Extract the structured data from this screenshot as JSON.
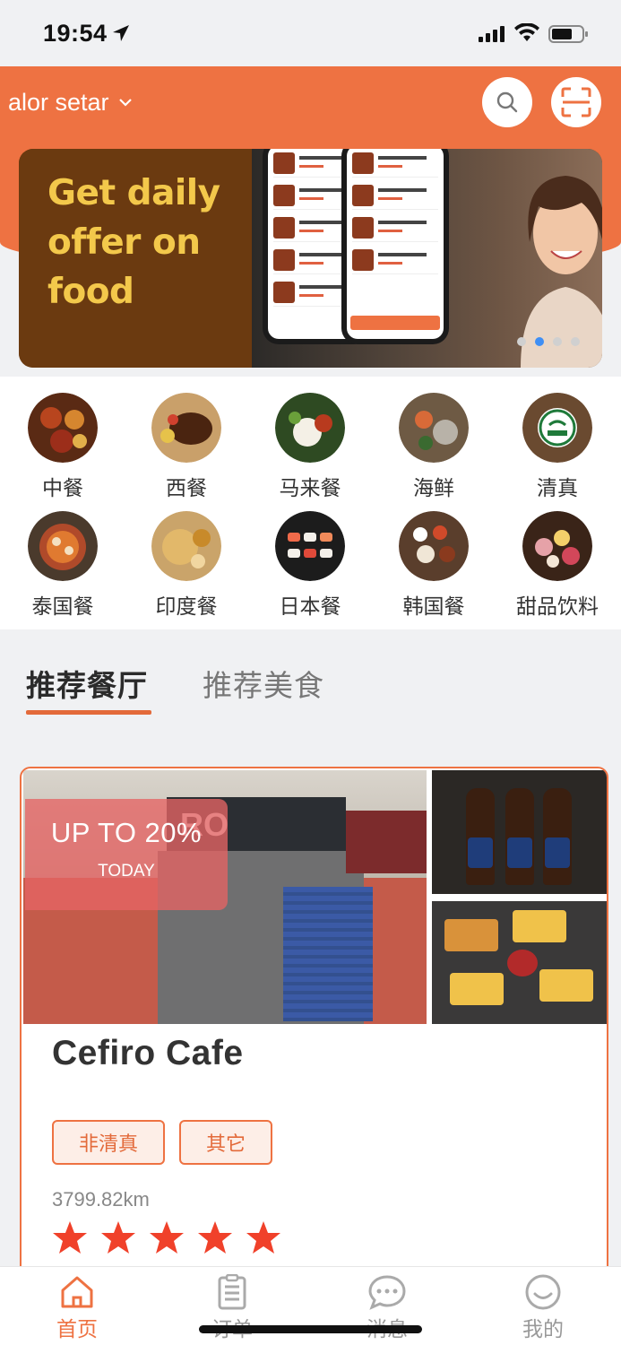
{
  "status_bar": {
    "time": "19:54"
  },
  "header": {
    "location": "alor setar"
  },
  "banner": {
    "lines": [
      "Get daily",
      "offer on",
      "food"
    ],
    "dots_total": 4,
    "active_dot": 2
  },
  "categories": [
    {
      "label": "中餐"
    },
    {
      "label": "西餐"
    },
    {
      "label": "马来餐"
    },
    {
      "label": "海鲜"
    },
    {
      "label": "清真"
    },
    {
      "label": "泰国餐"
    },
    {
      "label": "印度餐"
    },
    {
      "label": "日本餐"
    },
    {
      "label": "韩国餐"
    },
    {
      "label": "甜品饮料"
    }
  ],
  "tabs": {
    "active": "推荐餐厅",
    "inactive": "推荐美食"
  },
  "restaurant": {
    "name": "Cefiro Cafe",
    "promo": "UP TO 20%",
    "promo_sub": "TODAY",
    "sign_text": "RO",
    "tags": [
      "非清真",
      "其它"
    ],
    "distance": "3799.82km",
    "rating": 5
  },
  "nav": [
    {
      "label": "首页",
      "icon": "home-icon"
    },
    {
      "label": "订单",
      "icon": "orders-icon"
    },
    {
      "label": "消息",
      "icon": "message-icon"
    },
    {
      "label": "我的",
      "icon": "profile-icon"
    }
  ],
  "colors": {
    "accent": "#ee7242",
    "banner_text": "#f3c84b",
    "active_dot": "#3f8ff5",
    "star": "#f0412a"
  }
}
